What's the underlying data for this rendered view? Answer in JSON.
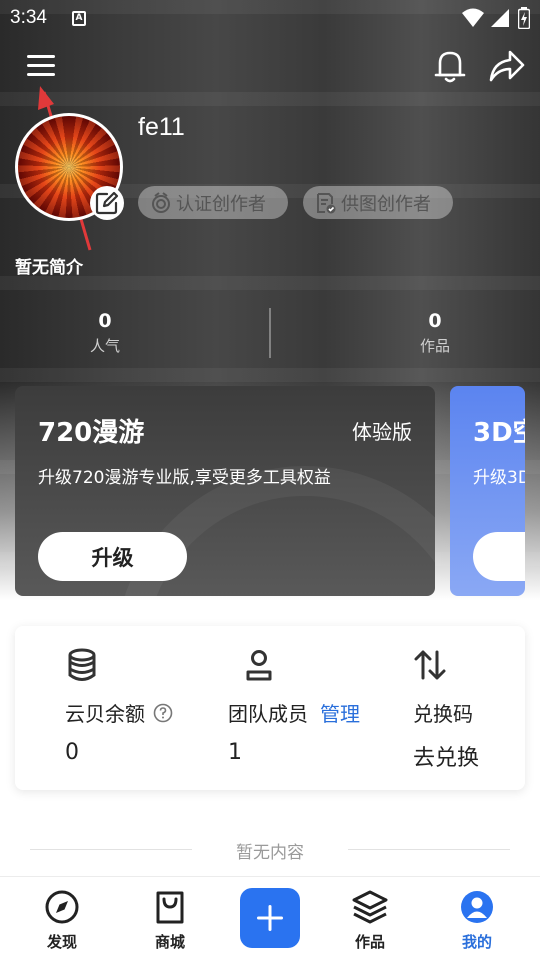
{
  "status_bar": {
    "time": "3:34",
    "notification_badge": "A"
  },
  "profile": {
    "username": "fe11",
    "tags": [
      "认证创作者",
      "供图创作者"
    ],
    "bio": "暂无简介",
    "stats": [
      {
        "value": "0",
        "label": "人气"
      },
      {
        "value": "0",
        "label": "作品"
      }
    ]
  },
  "promos": [
    {
      "title": "720漫游",
      "badge": "体验版",
      "desc": "升级720漫游专业版,享受更多工具权益",
      "button": "升级"
    },
    {
      "title": "3D空",
      "desc": "升级3D"
    }
  ],
  "panel": {
    "balance": {
      "label": "云贝余额",
      "value": "0"
    },
    "team": {
      "label": "团队成员",
      "link": "管理",
      "value": "1"
    },
    "redeem": {
      "label": "兑换码",
      "link": "去兑换"
    }
  },
  "empty_text": "暂无内容",
  "tabs": [
    {
      "label": "发现",
      "icon": "compass-icon"
    },
    {
      "label": "商城",
      "icon": "shopping-bag-icon"
    },
    {
      "label": "作品",
      "icon": "layers-icon"
    },
    {
      "label": "我的",
      "icon": "user-icon"
    }
  ],
  "colors": {
    "accent": "#2a73f0",
    "link": "#2a6fdb",
    "annotation": "#e0393a"
  }
}
